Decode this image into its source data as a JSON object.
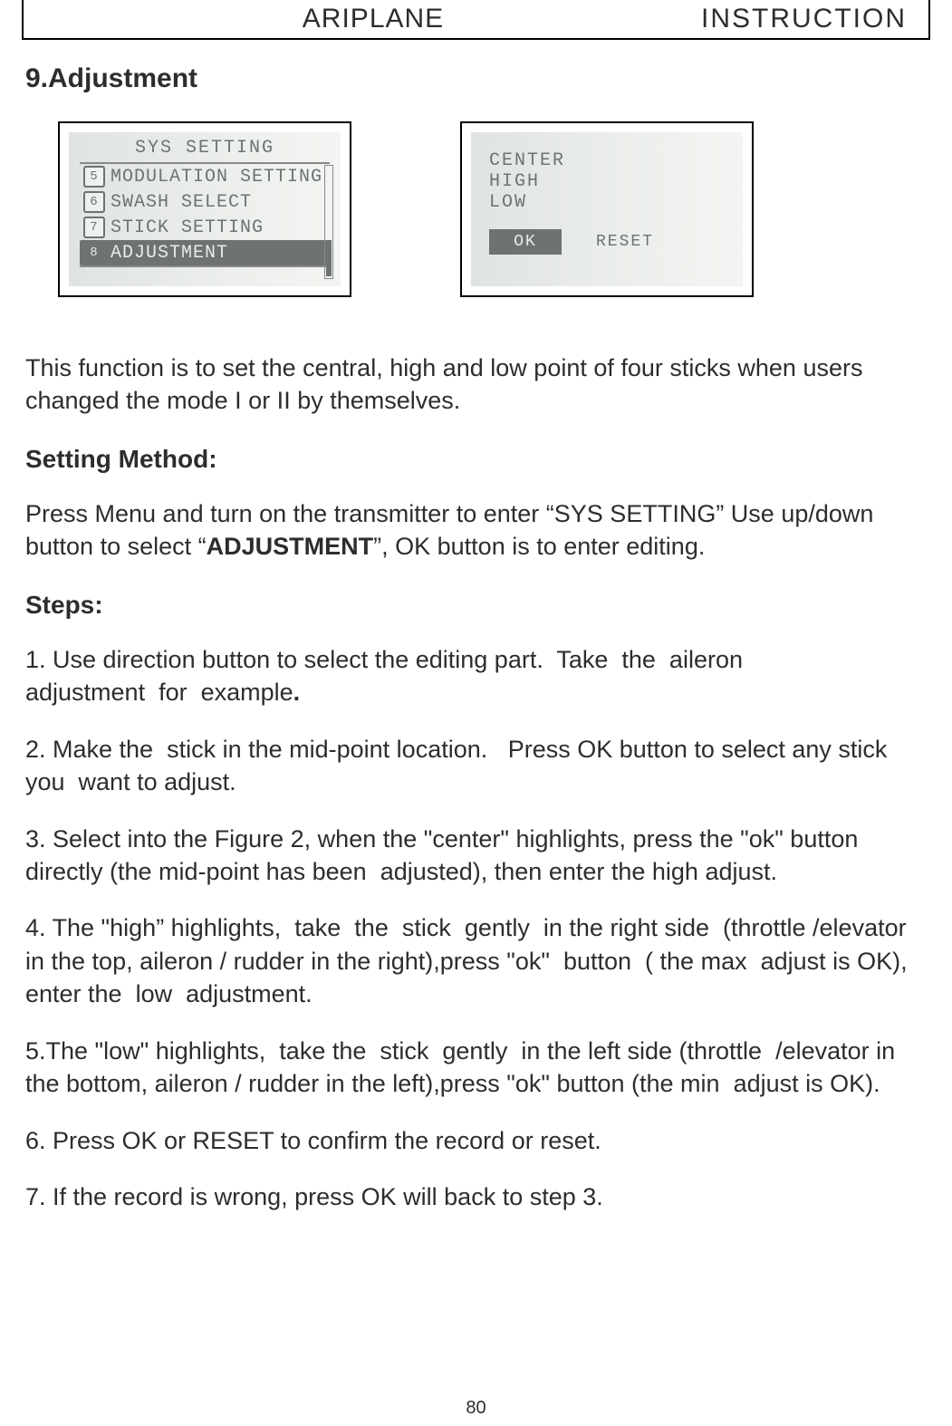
{
  "header": {
    "left": "ARIPLANE",
    "right": "INSTRUCTION"
  },
  "section_title": "9.Adjustment",
  "screen1": {
    "title": "SYS SETTING",
    "items": [
      {
        "num": "5",
        "label": "MODULATION SETTING",
        "selected": false
      },
      {
        "num": "6",
        "label": "SWASH SELECT",
        "selected": false
      },
      {
        "num": "7",
        "label": "STICK SETTING",
        "selected": false
      },
      {
        "num": "8",
        "label": "ADJUSTMENT",
        "selected": true
      }
    ]
  },
  "screen2": {
    "lines": [
      "CENTER",
      "HIGH",
      "LOW"
    ],
    "ok": "OK",
    "reset": "RESET"
  },
  "intro": "This function is to set the central, high and low point of four sticks when users changed the mode I or II by themselves.",
  "setting_method_head": "Setting Method:",
  "setting_method_pre": "Press Menu and turn on the transmitter to enter “SYS SETTING” Use up/down button to select “",
  "setting_method_bold": "ADJUSTMENT",
  "setting_method_post": "”, OK button is to enter editing.",
  "steps_head": "Steps:",
  "steps": {
    "s1a": "1. Use direction button to select the editing part.  Take  the  aileron",
    "s1b": "adjustment  for  example",
    "s1dot": ".",
    "s2": "2. Make the  stick in the mid-point location.   Press OK button to select any stick you  want to adjust.",
    "s3": "3. Select into the Figure 2, when the \"center\" highlights, press the \"ok\" button directly (the mid-point has been  adjusted), then enter the high adjust.",
    "s4": "4. The \"high” highlights,  take  the  stick  gently  in the right side  (throttle /elevator in the top, aileron / rudder in the right),press \"ok\"  button  ( the max  adjust is OK), enter the  low  adjustment.",
    "s5": "5.The \"low\" highlights,  take the  stick  gently  in the left side (throttle  /elevator in the bottom, aileron / rudder in the left),press \"ok\" button (the min  adjust is OK).",
    "s6": "6. Press OK or RESET to confirm the record or reset.",
    "s7": "7. If the record is wrong, press OK will back to step 3."
  },
  "page_number": "80"
}
